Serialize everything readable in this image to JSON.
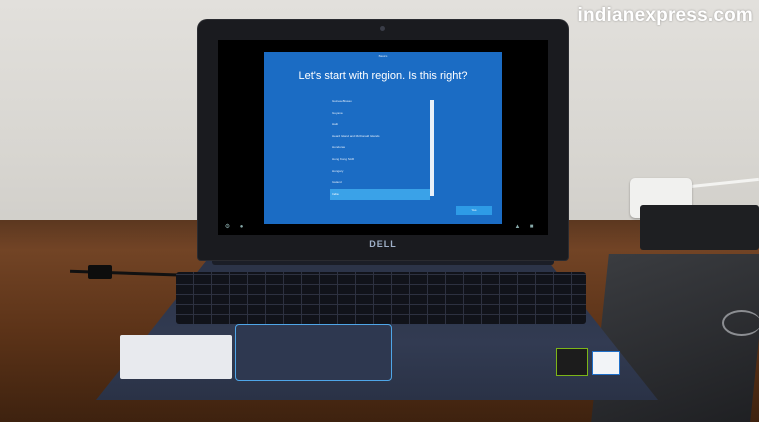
{
  "watermark": "indianexpress.com",
  "screen": {
    "top_label": "Basics",
    "title": "Let's start with region. Is this right?",
    "regions": [
      "Guinea-Bissau",
      "Guyana",
      "Haiti",
      "Heard Island and McDonald Islands",
      "Honduras",
      "Hong Kong SAR",
      "Hungary",
      "Iceland",
      "India"
    ],
    "selected_region": "India",
    "yes_label": "Yes"
  },
  "brand_logo": "DELL",
  "colors": {
    "oobe_background": "#1b6cc4",
    "selection": "#3aa2e8",
    "touchpad_accent": "#4fa6e8"
  }
}
